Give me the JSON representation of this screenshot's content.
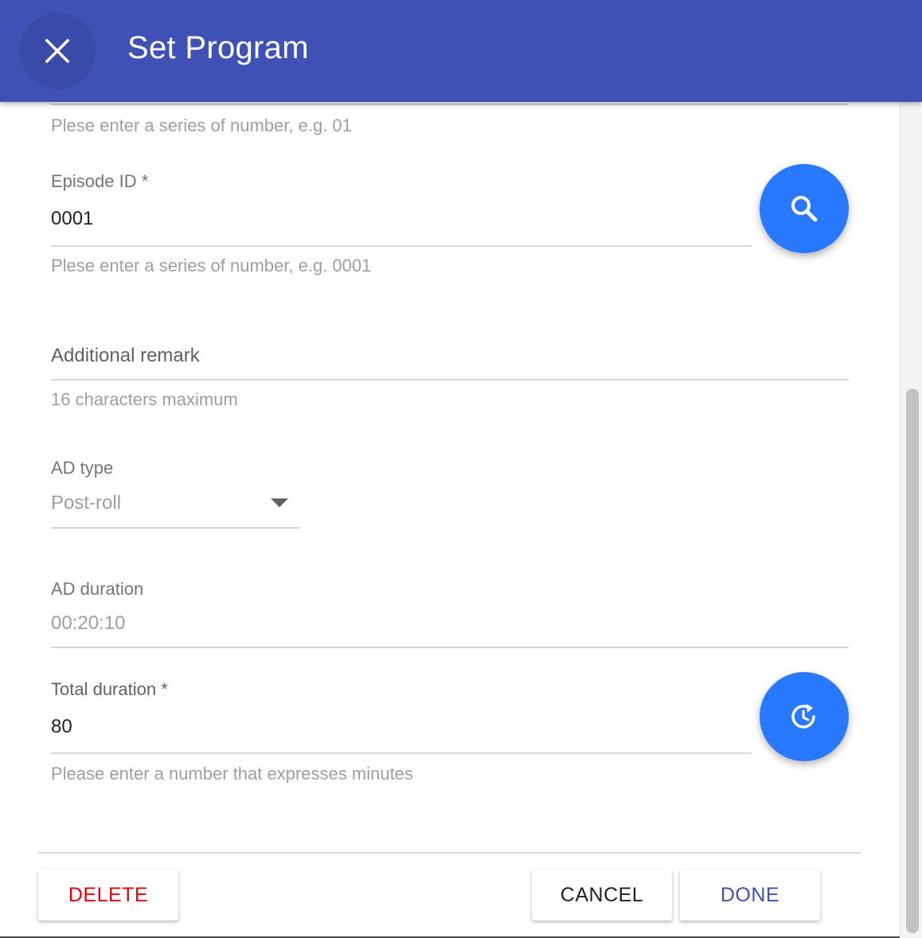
{
  "header": {
    "title": "Set Program"
  },
  "form": {
    "season_helper": "Plese enter a series of number, e.g. 01",
    "episode_id": {
      "label": "Episode ID *",
      "value": "0001",
      "helper": "Plese enter a series of number, e.g. 0001"
    },
    "additional_remark": {
      "placeholder": "Additional remark",
      "helper": "16 characters maximum"
    },
    "ad_type": {
      "label": "AD type",
      "value": "Post-roll"
    },
    "ad_duration": {
      "label": "AD duration",
      "value": "00:20:10"
    },
    "total_duration": {
      "label": "Total duration *",
      "value": "80",
      "helper": "Please enter a number that expresses minutes"
    }
  },
  "actions": {
    "delete_label": "DELETE",
    "cancel_label": "CANCEL",
    "done_label": "DONE"
  },
  "icons": {
    "close": "close-icon",
    "search": "search-icon",
    "refresh_duration": "clock-refresh-icon",
    "dropdown": "arrow-drop-down-icon"
  },
  "colors": {
    "appbar": "#3f51b5",
    "fab": "#2979ff",
    "delete": "#e5000b",
    "done": "#3f51b5"
  }
}
